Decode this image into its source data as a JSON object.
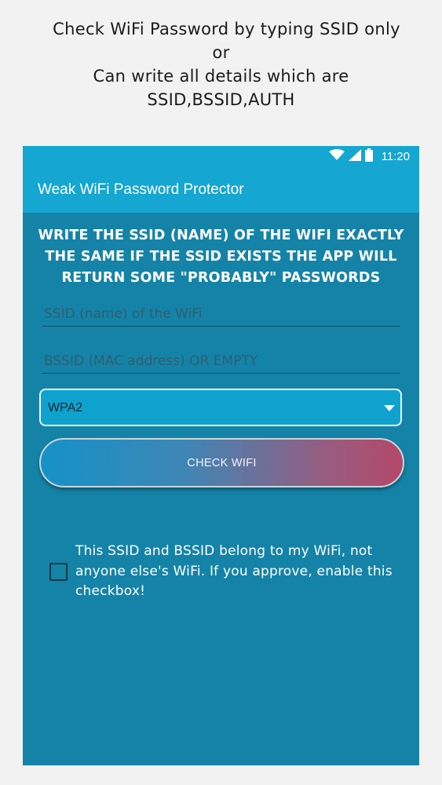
{
  "promo_caption": {
    "line1": "Check WiFi Password by typing SSID only",
    "line2": "or",
    "line3": "Can write all details which are",
    "line4": "SSID,BSSID,AUTH"
  },
  "status_bar": {
    "time": "11:20",
    "icons": [
      "wifi-icon",
      "signal-icon",
      "battery-icon"
    ]
  },
  "app_bar": {
    "title": "Weak WiFi Password Protector"
  },
  "instructions": "WRITE THE SSID (NAME) OF THE WIFI EXACTLY THE SAME IF THE SSID EXISTS THE APP WILL RETURN SOME \"PROBABLY\" PASSWORDS",
  "form": {
    "ssid_placeholder": "SSID (name) of the WiFi",
    "ssid_value": "",
    "bssid_placeholder": "BSSID (MAC address) OR EMPTY",
    "bssid_value": "",
    "auth_selected": "WPA2",
    "check_button_label": "CHECK WIFI",
    "consent_text": "This SSID and BSSID belong to my WiFi, not anyone else's WiFi. If you approve, enable this checkbox!",
    "consent_checked": false
  },
  "colors": {
    "status_bar": "#15a6d2",
    "background": "#1583a8",
    "button_gradient_start": "#1592c8",
    "button_gradient_end": "#b44869"
  }
}
